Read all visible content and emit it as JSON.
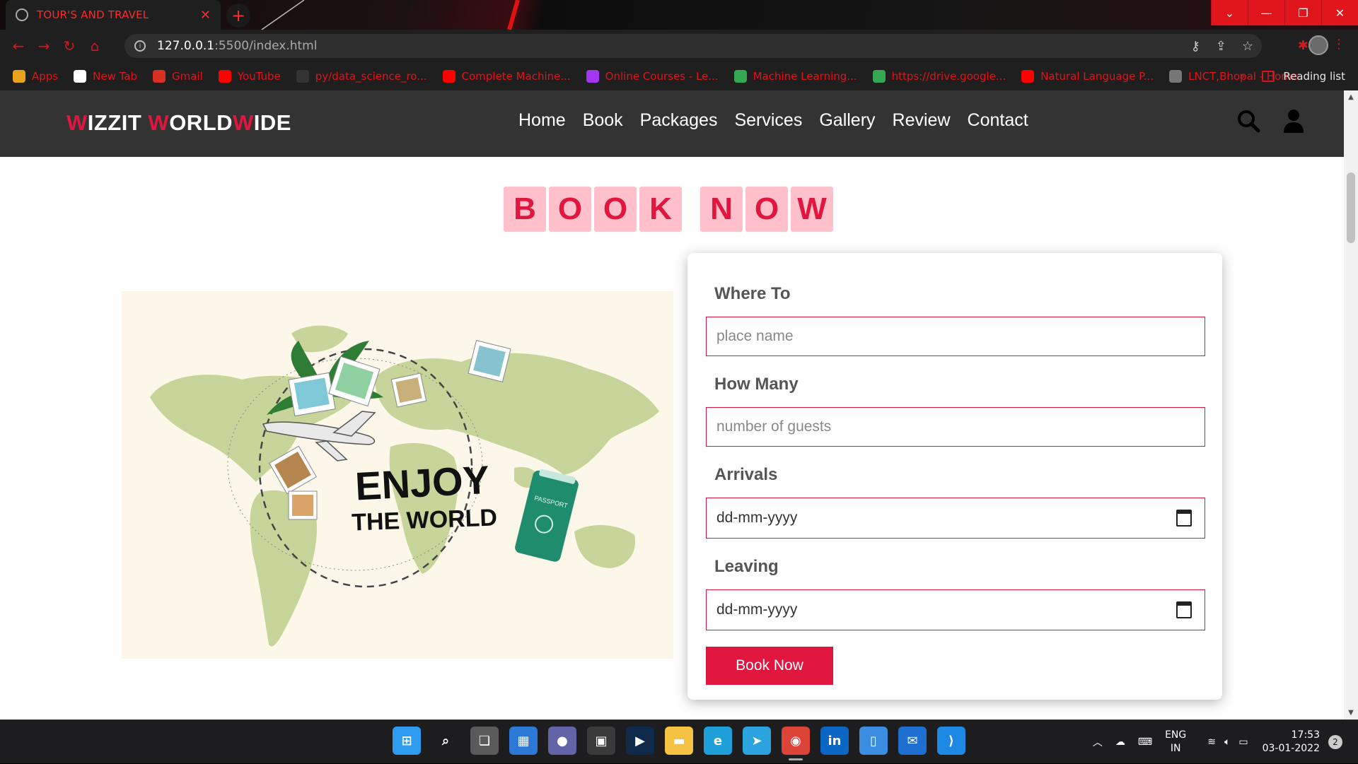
{
  "browser": {
    "tab_title": "TOUR'S AND TRAVEL",
    "tab_close": "✕",
    "new_tab": "+",
    "url_host": "127.0.0.1",
    "url_path": ":5500/index.html",
    "window_controls": {
      "dropdown": "⌄",
      "minimize": "—",
      "restore": "❐",
      "close": "✕"
    }
  },
  "bookmarks": [
    {
      "label": "Apps",
      "icon": "apps-grid-icon",
      "color": "#e8a21b"
    },
    {
      "label": "New Tab",
      "icon": "google-icon",
      "color": "#ffffff"
    },
    {
      "label": "Gmail",
      "icon": "gmail-icon",
      "color": "#d93025"
    },
    {
      "label": "YouTube",
      "icon": "youtube-icon",
      "color": "#ff0000"
    },
    {
      "label": "py/data_science_ro...",
      "icon": "github-icon",
      "color": "#333333"
    },
    {
      "label": "Complete Machine...",
      "icon": "youtube-icon",
      "color": "#ff0000"
    },
    {
      "label": "Online Courses - Le...",
      "icon": "udemy-icon",
      "color": "#a435f0"
    },
    {
      "label": "Machine Learning...",
      "icon": "drive-icon",
      "color": "#34a853"
    },
    {
      "label": "https://drive.google...",
      "icon": "drive-icon",
      "color": "#34a853"
    },
    {
      "label": "Natural Language P...",
      "icon": "youtube-icon",
      "color": "#ff0000"
    },
    {
      "label": "LNCT,Bhopal - Home",
      "icon": "lnct-icon",
      "color": "#777777"
    }
  ],
  "reading_list": "Reading list",
  "site": {
    "logo_parts": [
      {
        "t": "W",
        "accent": true
      },
      {
        "t": "IZZIT ",
        "accent": false
      },
      {
        "t": "W",
        "accent": true
      },
      {
        "t": "ORLD",
        "accent": false
      },
      {
        "t": "W",
        "accent": true
      },
      {
        "t": "IDE",
        "accent": false
      }
    ],
    "nav": [
      "Home",
      "Book",
      "Packages",
      "Services",
      "Gallery",
      "Review",
      "Contact"
    ]
  },
  "book_section": {
    "heading_word1": [
      "B",
      "O",
      "O",
      "K"
    ],
    "heading_word2": [
      "N",
      "O",
      "W"
    ],
    "image_text_line1": "ENJOY",
    "image_text_line2": "THE WORLD",
    "passport_text": "PASSPORT",
    "form": {
      "where_label": "Where To",
      "where_placeholder": "place name",
      "howmany_label": "How Many",
      "howmany_placeholder": "number of guests",
      "arrivals_label": "Arrivals",
      "arrivals_value": "dd-mm-yyyy",
      "leaving_label": "Leaving",
      "leaving_value": "dd-mm-yyyy",
      "submit": "Book Now"
    },
    "accent_color": "#e0163f",
    "letter_bg": "#ffc0cb"
  },
  "taskbar": {
    "apps": [
      "windows-start-icon",
      "search-icon",
      "task-view-icon",
      "widgets-icon",
      "teams-chat-icon",
      "store-icon",
      "prime-video-icon",
      "file-explorer-icon",
      "edge-icon",
      "telegram-icon",
      "chrome-icon",
      "linkedin-icon",
      "notepad-icon",
      "mail-icon",
      "vscode-icon"
    ],
    "lang_line1": "ENG",
    "lang_line2": "IN",
    "time": "17:53",
    "date": "03-01-2022",
    "notifications": "2"
  }
}
